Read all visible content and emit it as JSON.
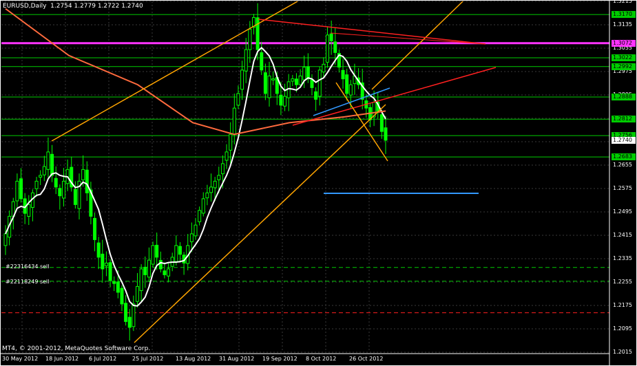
{
  "window": {
    "symbol": "EURUSD,Daily",
    "ohlc": "1.2754 1.2779 1.2722 1.2740",
    "copyright": "MT4, © 2001-2012, MetaQuotes Software Corp."
  },
  "price_axis": {
    "min": 1.2015,
    "max": 1.3215,
    "ticks": [
      "1.3215",
      "1.3135",
      "1.3055",
      "1.2975",
      "1.2895",
      "1.2815",
      "1.2735",
      "1.2655",
      "1.2575",
      "1.2495",
      "1.2415",
      "1.2335",
      "1.2255",
      "1.2175",
      "1.2095",
      "1.2015"
    ],
    "tick_values": [
      1.3215,
      1.3135,
      1.3055,
      1.2975,
      1.2895,
      1.2815,
      1.2735,
      1.2655,
      1.2575,
      1.2495,
      1.2415,
      1.2335,
      1.2255,
      1.2175,
      1.2095,
      1.2015
    ]
  },
  "level_labels": [
    {
      "text": "1.3170",
      "value": 1.317,
      "bg": "#00cc00",
      "fg": "#000000"
    },
    {
      "text": "1.3072",
      "value": 1.3072,
      "bg": "#ff33ff",
      "fg": "#000000"
    },
    {
      "text": "1.3022",
      "value": 1.3022,
      "bg": "#00cc00",
      "fg": "#000000"
    },
    {
      "text": "1.2992",
      "value": 1.2992,
      "bg": "#00cc00",
      "fg": "#000000"
    },
    {
      "text": "1.2888",
      "value": 1.2888,
      "bg": "#00cc00",
      "fg": "#000000"
    },
    {
      "text": "1.2812",
      "value": 1.2812,
      "bg": "#00cc00",
      "fg": "#000000"
    },
    {
      "text": "1.2756",
      "value": 1.2756,
      "bg": "#00cc00",
      "fg": "#000000"
    },
    {
      "text": "1.2740",
      "value": 1.274,
      "bg": "#ffffff",
      "fg": "#000000"
    },
    {
      "text": "1.2683",
      "value": 1.2683,
      "bg": "#00cc00",
      "fg": "#000000"
    }
  ],
  "time_axis": {
    "labels": [
      "30 May 2012",
      "18 Jun 2012",
      "6 Jul 2012",
      "25 Jul 2012",
      "13 Aug 2012",
      "31 Aug 2012",
      "19 Sep 2012",
      "8 Oct 2012",
      "26 Oct 2012"
    ]
  },
  "orders": [
    {
      "label": "#22316434 sell",
      "value": 1.2305
    },
    {
      "label": "#22118249 sell",
      "value": 1.2258
    }
  ],
  "colors": {
    "bull_candle": "#00ff00",
    "bear_candle": "#00ff00",
    "grid": "#3a3a3a",
    "ma_fast": "#ffffff",
    "ma_slow": "#ff6a3d",
    "channel": "#ffa500",
    "resistance": "#ff2020",
    "magenta_level": "#ff33ff",
    "blue_lines": "#3399ff",
    "level_lines": "#00cc00"
  },
  "chart_data": {
    "type": "candlestick",
    "symbol": "EURUSD",
    "timeframe": "Daily",
    "ylim": [
      1.2015,
      1.3215
    ],
    "close_path": [
      1.242,
      1.248,
      1.253,
      1.26,
      1.254,
      1.249,
      1.252,
      1.256,
      1.26,
      1.262,
      1.265,
      1.27,
      1.262,
      1.258,
      1.255,
      1.26,
      1.264,
      1.258,
      1.252,
      1.26,
      1.264,
      1.256,
      1.248,
      1.24,
      1.234,
      1.23,
      1.232,
      1.226,
      1.225,
      1.222,
      1.218,
      1.212,
      1.21,
      1.218,
      1.224,
      1.23,
      1.228,
      1.233,
      1.238,
      1.234,
      1.23,
      1.228,
      1.23,
      1.234,
      1.238,
      1.235,
      1.232,
      1.238,
      1.242,
      1.245,
      1.25,
      1.254,
      1.256,
      1.258,
      1.26,
      1.262,
      1.266,
      1.27,
      1.276,
      1.285,
      1.29,
      1.298,
      1.305,
      1.312,
      1.316,
      1.305,
      1.298,
      1.29,
      1.296,
      1.295,
      1.29,
      1.286,
      1.289,
      1.294,
      1.295,
      1.293,
      1.296,
      1.299,
      1.295,
      1.292,
      1.288,
      1.298,
      1.3,
      1.31,
      1.308,
      1.304,
      1.299,
      1.295,
      1.29,
      1.293,
      1.296,
      1.293,
      1.288,
      1.285,
      1.281,
      1.287,
      1.284,
      1.277,
      1.274
    ],
    "horizontal_levels": [
      1.317,
      1.3072,
      1.3022,
      1.2992,
      1.2888,
      1.2812,
      1.2756,
      1.2683
    ]
  }
}
